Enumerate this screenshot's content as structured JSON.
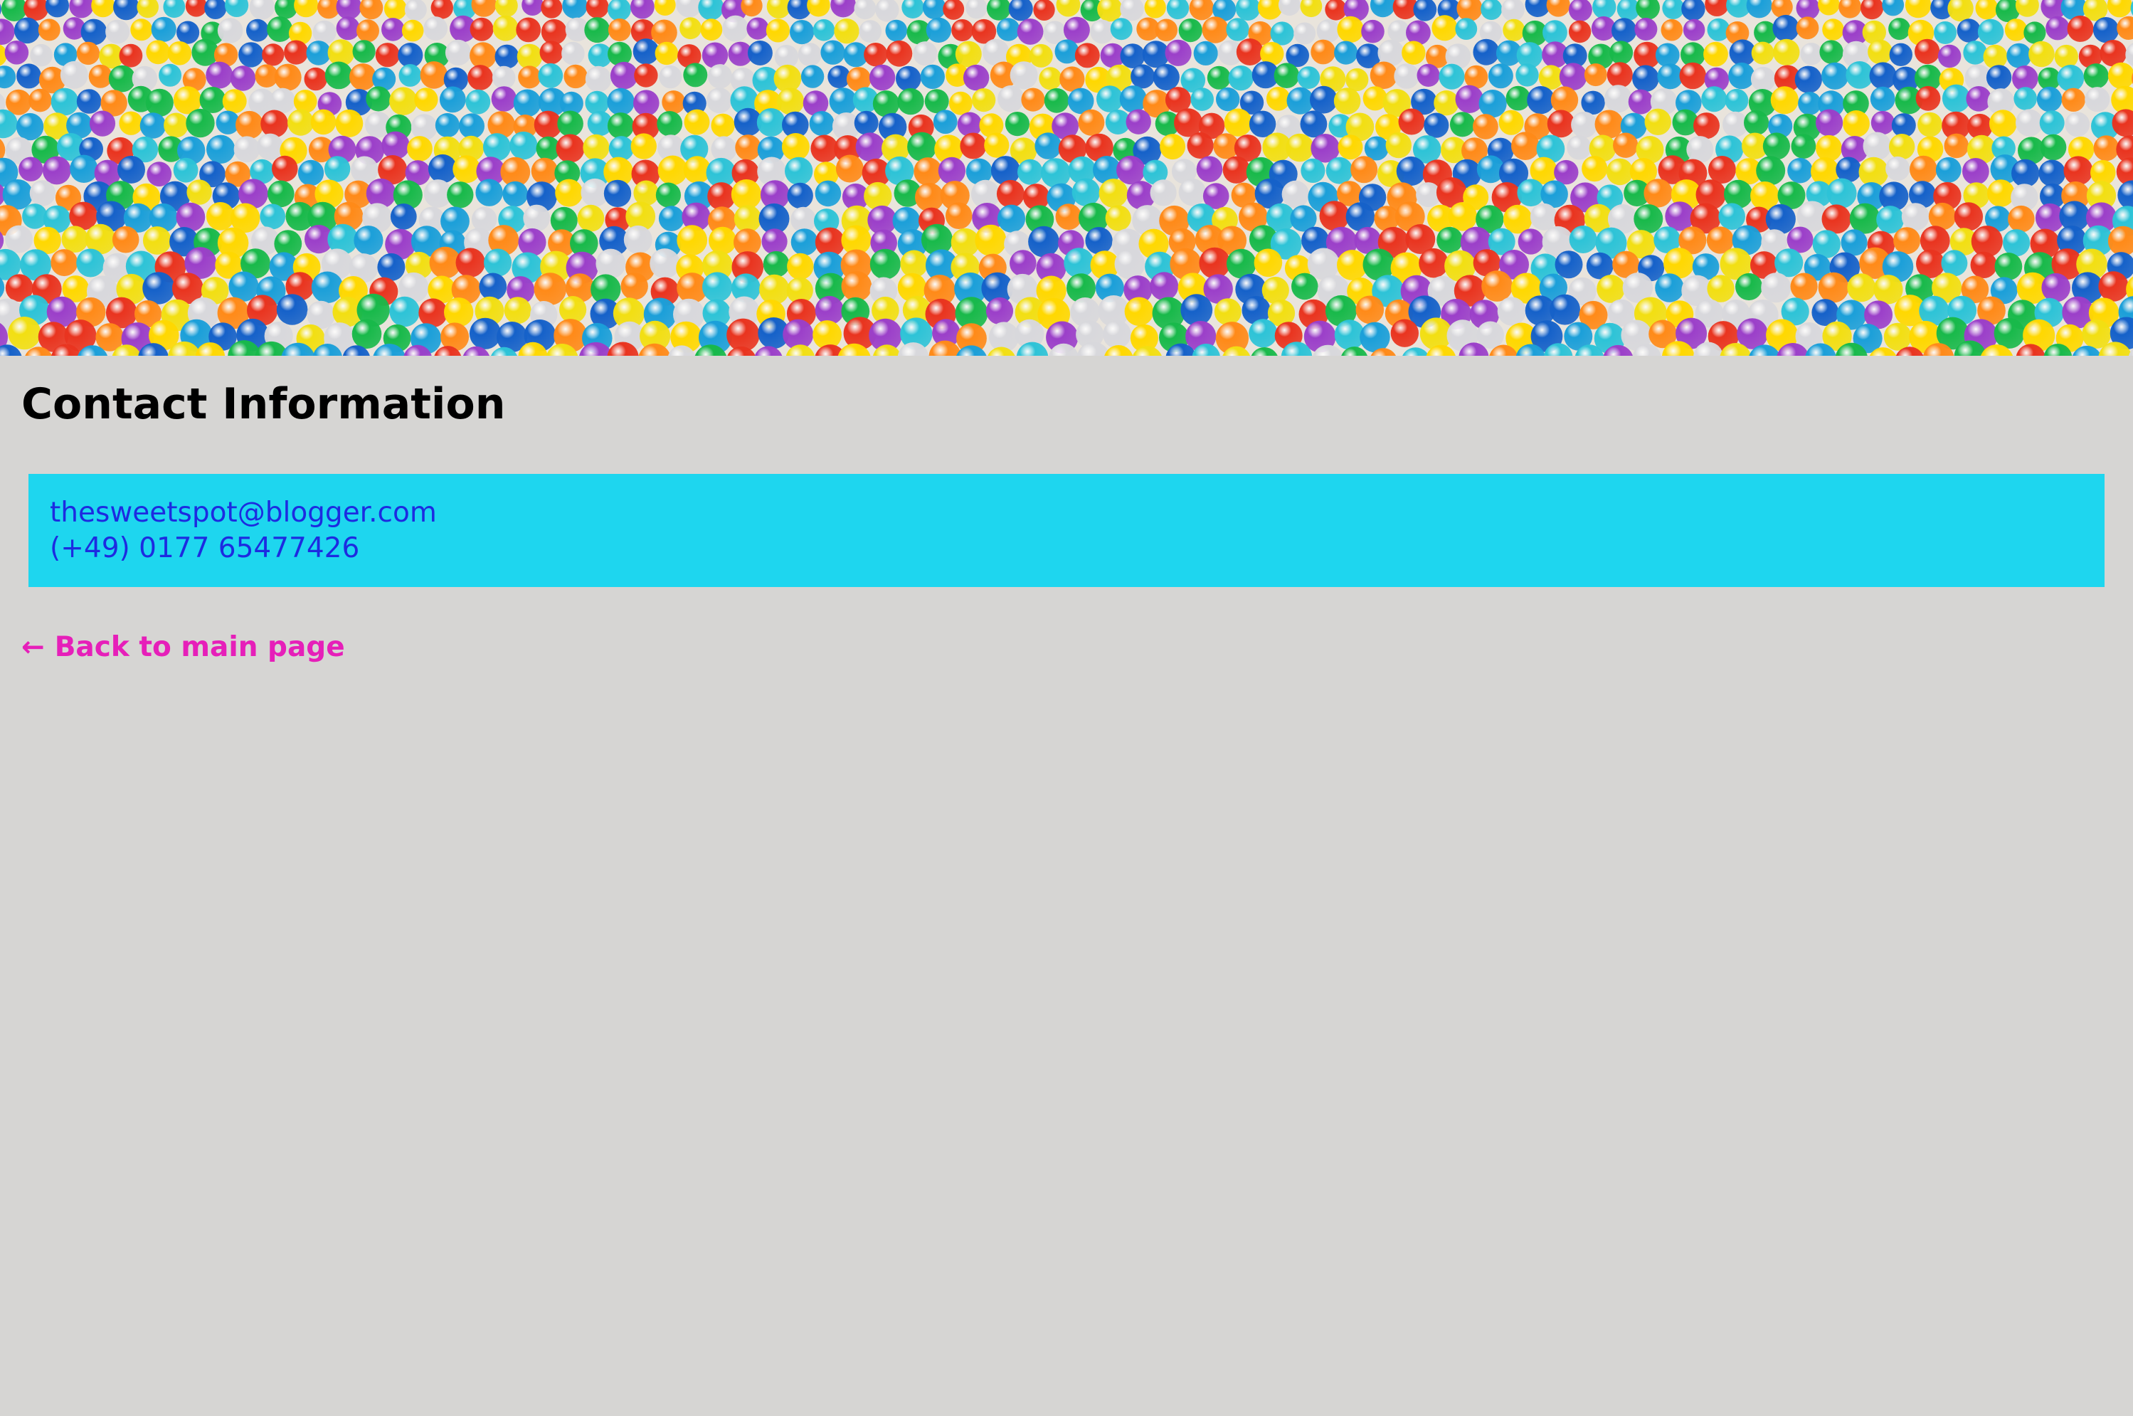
{
  "hero": {
    "image": "colorful-ball-pit-photo",
    "palette": [
      "#f2df12",
      "#1b9fd9",
      "#1561c9",
      "#9b3fc9",
      "#e9341f",
      "#ff8a18",
      "#18b94a",
      "#d8d8dc",
      "#2dc3d7",
      "#ffd800"
    ]
  },
  "page": {
    "title": "Contact Information"
  },
  "contact": {
    "email": "thesweetspot@blogger.com",
    "phone": "(+49) 0177 65477426"
  },
  "back_link": {
    "arrow": "←",
    "label": "Back to main page"
  },
  "colors": {
    "background": "#d6d5d3",
    "contact_box": "#1ed6ef",
    "contact_text": "#1d2be0",
    "back_link": "#e61fb9"
  }
}
